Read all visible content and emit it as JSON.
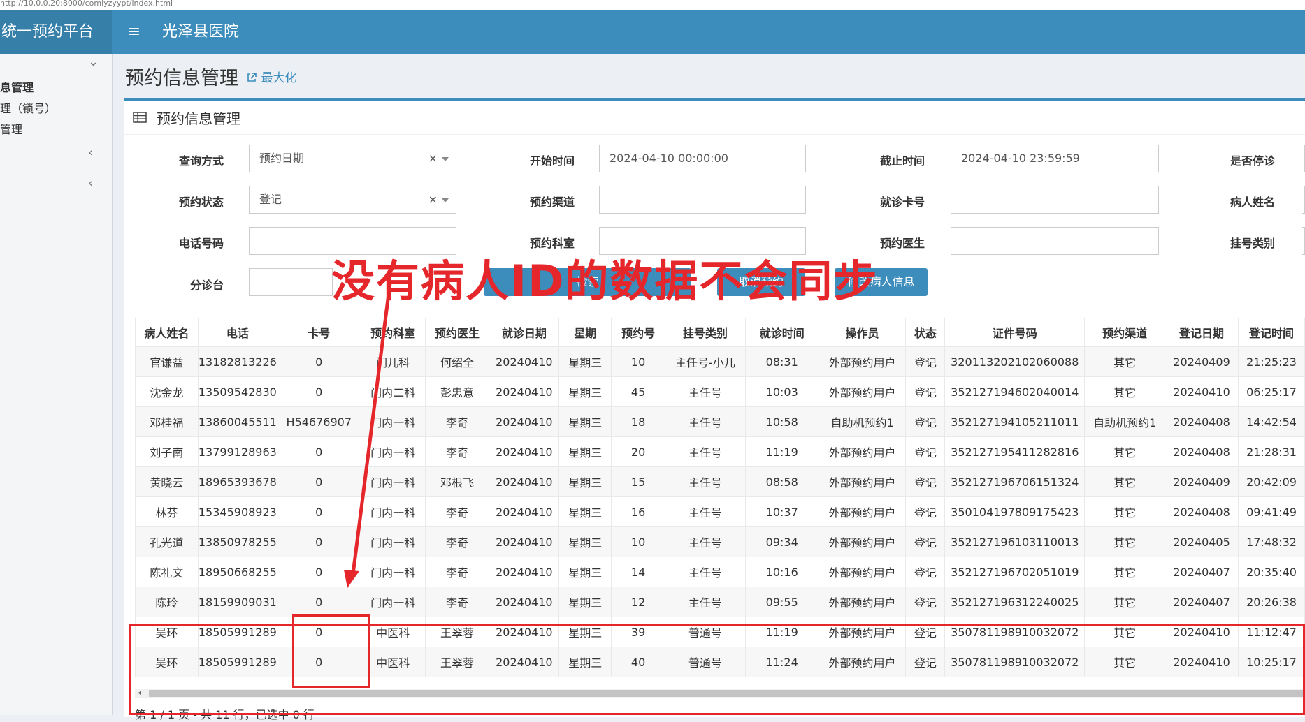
{
  "browser": {
    "url": "http://10.0.0.20:8000/comlyzyypt/index.html"
  },
  "header": {
    "brand": "统一预约平台",
    "menu_icon": "≡",
    "hospital": "光泽县医院"
  },
  "sidebar": {
    "items": [
      {
        "label": "息管理"
      },
      {
        "label": "理（锁号）"
      },
      {
        "label": "管理"
      }
    ]
  },
  "page": {
    "title": "预约信息管理",
    "maximize": "最大化",
    "box_title": "预约信息管理"
  },
  "form": {
    "query_mode_label": "查询方式",
    "query_mode_value": "预约日期",
    "start_label": "开始时间",
    "start_value": "2024-04-10 00:00:00",
    "end_label": "截止时间",
    "end_value": "2024-04-10 23:59:59",
    "stop_label": "是否停诊",
    "status_label": "预约状态",
    "status_value": "登记",
    "channel_label": "预约渠道",
    "card_label": "就诊卡号",
    "patient_label": "病人姓名",
    "phone_label": "电话号码",
    "dept_label": "预约科室",
    "doctor_label": "预约医生",
    "regtype_label": "挂号类别",
    "triage_label": "分诊台",
    "search_btn": "检索",
    "cancel_btn": "取消预约",
    "modify_btn": "修改病人信息"
  },
  "annotation": {
    "text": "没有病人ID的数据不会同步"
  },
  "table": {
    "columns": [
      "病人姓名",
      "电话",
      "卡号",
      "预约科室",
      "预约医生",
      "就诊日期",
      "星期",
      "预约号",
      "挂号类别",
      "就诊时间",
      "操作员",
      "状态",
      "证件号码",
      "预约渠道",
      "登记日期",
      "登记时间"
    ],
    "rows": [
      [
        "官谦益",
        "13182813226",
        "0",
        "门儿科",
        "何绍全",
        "20240410",
        "星期三",
        "10",
        "主任号-小儿",
        "08:31",
        "外部预约用户",
        "登记",
        "320113202102060088",
        "其它",
        "20240409",
        "21:25:23"
      ],
      [
        "沈金龙",
        "13509542830",
        "0",
        "门内二科",
        "彭忠意",
        "20240410",
        "星期三",
        "45",
        "主任号",
        "10:03",
        "外部预约用户",
        "登记",
        "352127194602040014",
        "其它",
        "20240410",
        "06:25:17"
      ],
      [
        "邓桂福",
        "13860045511",
        "H54676907",
        "门内一科",
        "李奇",
        "20240410",
        "星期三",
        "18",
        "主任号",
        "10:58",
        "自助机预约1",
        "登记",
        "352127194105211011",
        "自助机预约1",
        "20240408",
        "14:42:54"
      ],
      [
        "刘子南",
        "13799128963",
        "0",
        "门内一科",
        "李奇",
        "20240410",
        "星期三",
        "20",
        "主任号",
        "11:19",
        "外部预约用户",
        "登记",
        "352127195411282816",
        "其它",
        "20240408",
        "21:28:31"
      ],
      [
        "黄晓云",
        "18965393678",
        "0",
        "门内一科",
        "邓根飞",
        "20240410",
        "星期三",
        "15",
        "主任号",
        "08:58",
        "外部预约用户",
        "登记",
        "352127196706151324",
        "其它",
        "20240409",
        "20:42:09"
      ],
      [
        "林芬",
        "15345908923",
        "0",
        "门内一科",
        "李奇",
        "20240410",
        "星期三",
        "16",
        "主任号",
        "10:37",
        "外部预约用户",
        "登记",
        "350104197809175423",
        "其它",
        "20240408",
        "09:41:49"
      ],
      [
        "孔光道",
        "13850978255",
        "0",
        "门内一科",
        "李奇",
        "20240410",
        "星期三",
        "10",
        "主任号",
        "09:34",
        "外部预约用户",
        "登记",
        "352127196103110013",
        "其它",
        "20240405",
        "17:48:32"
      ],
      [
        "陈礼文",
        "18950668255",
        "0",
        "门内一科",
        "李奇",
        "20240410",
        "星期三",
        "14",
        "主任号",
        "10:16",
        "外部预约用户",
        "登记",
        "352127196702051019",
        "其它",
        "20240407",
        "20:35:40"
      ],
      [
        "陈玲",
        "18159909031",
        "0",
        "门内一科",
        "李奇",
        "20240410",
        "星期三",
        "12",
        "主任号",
        "09:55",
        "外部预约用户",
        "登记",
        "352127196312240025",
        "其它",
        "20240407",
        "20:26:38"
      ],
      [
        "吴环",
        "18505991289",
        "0",
        "中医科",
        "王翠蓉",
        "20240410",
        "星期三",
        "39",
        "普通号",
        "11:19",
        "外部预约用户",
        "登记",
        "350781198910032072",
        "其它",
        "20240410",
        "11:12:47"
      ],
      [
        "吴环",
        "18505991289",
        "0",
        "中医科",
        "王翠蓉",
        "20240410",
        "星期三",
        "40",
        "普通号",
        "11:24",
        "外部预约用户",
        "登记",
        "350781198910032072",
        "其它",
        "20240410",
        "10:25:17"
      ]
    ]
  },
  "footer": {
    "text": "第 1 / 1 页 - 共 11 行，已选中 0 行"
  },
  "colors": {
    "header": "#3c8dbc",
    "annotation": "#e5262b"
  }
}
